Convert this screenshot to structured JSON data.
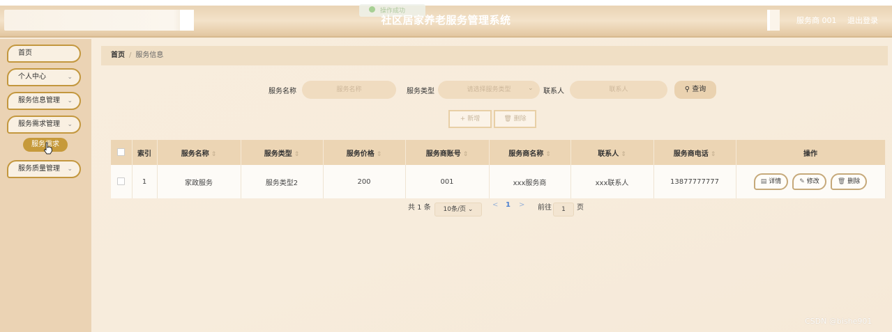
{
  "header": {
    "toast_text": "操作成功",
    "title": "社区居家养老服务管理系统",
    "user": "服务商 001",
    "logout": "退出登录"
  },
  "sidebar": {
    "items": [
      {
        "label": "首页",
        "has_chevron": false
      },
      {
        "label": "个人中心",
        "has_chevron": true
      },
      {
        "label": "服务信息管理",
        "has_chevron": true
      },
      {
        "label": "服务需求管理",
        "has_chevron": true
      },
      {
        "label": "服务质量管理",
        "has_chevron": true
      }
    ],
    "active_sub": "服务需求",
    "chevron": "⌄"
  },
  "breadcrumb": {
    "home": "首页",
    "separator": "/",
    "current": "服务信息"
  },
  "search": {
    "name_label": "服务名称",
    "name_placeholder": "服务名称",
    "type_label": "服务类型",
    "type_placeholder": "请选择服务类型",
    "contact_label": "联系人",
    "contact_placeholder": "联系人",
    "query_label": "查询"
  },
  "actions": {
    "add_label": "+ 新增",
    "delete_label": "删除"
  },
  "table": {
    "columns": [
      "索引",
      "服务名称",
      "服务类型",
      "服务价格",
      "服务商账号",
      "服务商名称",
      "联系人",
      "服务商电话",
      "操作"
    ],
    "sort_arrow": "⇕",
    "rows": [
      {
        "index": "1",
        "service_name": "家政服务",
        "service_type": "服务类型2",
        "price": "200",
        "provider_account": "001",
        "provider_name": "xxx服务商",
        "contact": "xxx联系人",
        "phone": "13877777777"
      }
    ],
    "ops": {
      "detail": "详情",
      "edit": "修改",
      "delete": "删除"
    }
  },
  "pagination": {
    "total": "共 1 条",
    "page_size": "10条/页",
    "prev": "<",
    "current_page": "1",
    "next": ">",
    "goto_label": "前往",
    "goto_value": "1",
    "page_suffix": "页"
  },
  "watermark": "CSDN @bishe901",
  "colors": {
    "accent_gold": "#c69a3b",
    "sidebar_bg": "#ebd3b4",
    "header_bg": "#e6cca8"
  }
}
